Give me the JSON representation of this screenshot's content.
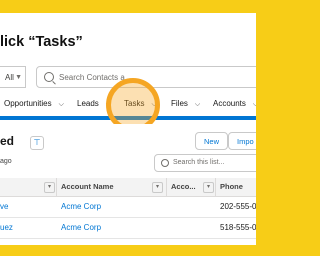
{
  "instruction": "lick “Tasks”",
  "search": {
    "scope": "All",
    "placeholder": "Search Contacts a..."
  },
  "nav": {
    "items": [
      {
        "label": "Opportunities"
      },
      {
        "label": "Leads"
      },
      {
        "label": "Tasks"
      },
      {
        "label": "Files"
      },
      {
        "label": "Accounts"
      }
    ]
  },
  "list": {
    "title": "ed",
    "subtitle": "ago",
    "new_label": "New",
    "import_label": "Impo",
    "search_placeholder": "Search this list..."
  },
  "table": {
    "headers": [
      "Account Name",
      "Acco...",
      "Phone"
    ],
    "rows": [
      {
        "name": "ve",
        "account": "Acme Corp",
        "phone": "202-555-0"
      },
      {
        "name": "uez",
        "account": "Acme Corp",
        "phone": "518-555-0"
      }
    ]
  },
  "colors": {
    "frame": "#f7cd17",
    "accent": "#0176d3",
    "highlight": "#f5a623"
  }
}
